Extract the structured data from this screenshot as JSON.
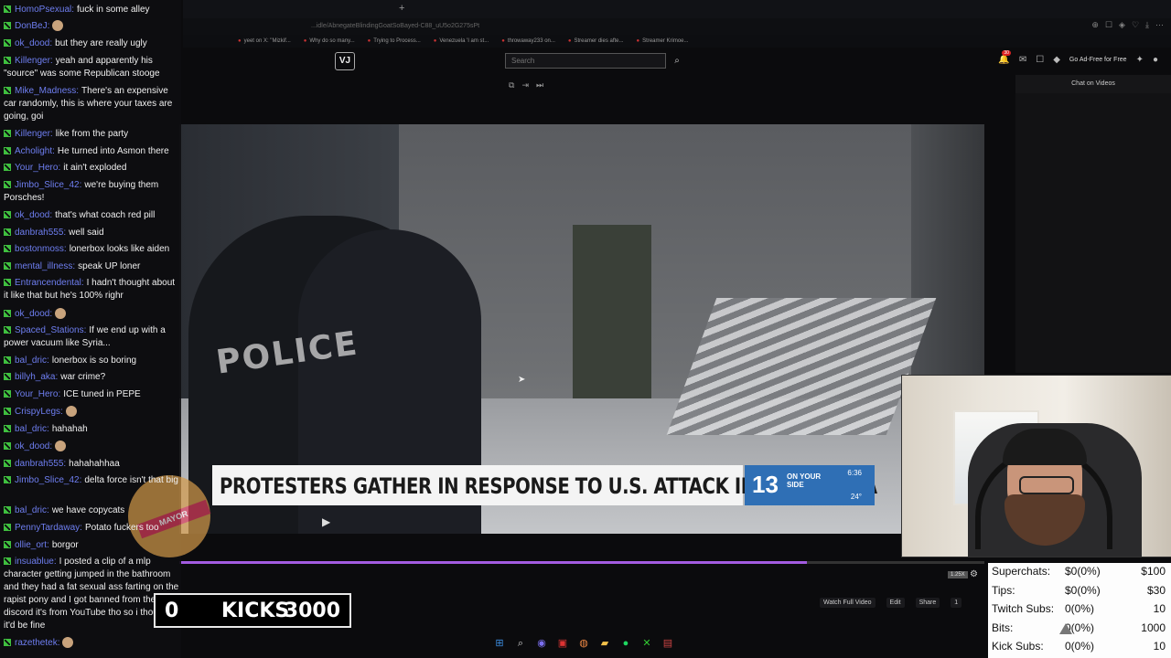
{
  "browser": {
    "new_tab": "+",
    "address": "...idle/AbnegateBlindingGoatSoBayed-C88_uU5o2G275sPt",
    "bookmarks": [
      "yeet on X: \"Mizkif...",
      "Why do so many...",
      "Trying to Process...",
      "Venezuela 'I am st...",
      "throwaway233 on...",
      "Streamer dies afte...",
      "Streamer Krimoe..."
    ]
  },
  "site": {
    "logo": "VJ",
    "search_placeholder": "Search",
    "notif_count": "30",
    "ad_free": "Go Ad-Free for Free"
  },
  "right_chat": {
    "title": "Chat on Videos"
  },
  "video": {
    "police_text": "POLICE",
    "chyron": "PROTESTERS GATHER IN RESPONSE TO U.S. ATTACK IN VENEZUELA",
    "station_number": "13",
    "station_slogan": "ON YOUR SIDE",
    "time": "6:36",
    "temp": "24°",
    "progress": 0.78,
    "speed": "1.25X",
    "actions": {
      "watch_full": "Watch Full Video",
      "edit": "Edit",
      "share": "Share",
      "like": "1"
    }
  },
  "kicks": {
    "count": "0",
    "label": "KICKS",
    "goal": "3000"
  },
  "stats": [
    {
      "label": "Superchats:",
      "value": "$0(0%)",
      "goal": "$100"
    },
    {
      "label": "Tips:",
      "value": "$0(0%)",
      "goal": "$30"
    },
    {
      "label": "Twitch Subs:",
      "value": "0(0%)",
      "goal": "10"
    },
    {
      "label": "Bits:",
      "value": "0(0%)",
      "goal": "1000"
    },
    {
      "label": "Kick Subs:",
      "value": "0(0%)",
      "goal": "10"
    }
  ],
  "chat": [
    {
      "user": "HomoPsexual:",
      "text": "fuck in some alley"
    },
    {
      "user": "DonBeJ:",
      "text": ""
    },
    {
      "user": "ok_dood:",
      "text": "but they are really ugly"
    },
    {
      "user": "Killenger:",
      "text": "yeah and apparently his \"source\" was some Republican stooge"
    },
    {
      "user": "Mike_Madness:",
      "text": "There's an expensive car randomly, this is where your taxes are going, goi"
    },
    {
      "user": "Killenger:",
      "text": "like from the party"
    },
    {
      "user": "Acholight:",
      "text": "He turned into Asmon there"
    },
    {
      "user": "Your_Hero:",
      "text": "it ain't exploded"
    },
    {
      "user": "Jimbo_Slice_42:",
      "text": "we're buying them Porsches!"
    },
    {
      "user": "ok_dood:",
      "text": "that's what coach red pill"
    },
    {
      "user": "danbrah555:",
      "text": "well said"
    },
    {
      "user": "bostonmoss:",
      "text": "lonerbox looks like aiden"
    },
    {
      "user": "mental_illness:",
      "text": "speak UP loner"
    },
    {
      "user": "Entrancendental:",
      "text": "I hadn't thought about it like that but he's 100% righr"
    },
    {
      "user": "ok_dood:",
      "text": ""
    },
    {
      "user": "Spaced_Stations:",
      "text": "If we end up with a power vacuum like Syria..."
    },
    {
      "user": "bal_dric:",
      "text": "lonerbox is so boring"
    },
    {
      "user": "billyh_aka:",
      "text": "war crime?"
    },
    {
      "user": "Your_Hero:",
      "text": "ICE tuned in PEPE"
    },
    {
      "user": "CrispyLegs:",
      "text": ""
    },
    {
      "user": "bal_dric:",
      "text": "hahahah"
    },
    {
      "user": "ok_dood:",
      "text": ""
    },
    {
      "user": "danbrah555:",
      "text": "hahahahhaa"
    },
    {
      "user": "Jimbo_Slice_42:",
      "text": "delta force isn't that big"
    },
    {
      "user": "bal_dric:",
      "text": "we have copycats"
    },
    {
      "user": "PennyTardaway:",
      "text": "Potato fuckers too"
    },
    {
      "user": "ollie_ort:",
      "text": "borgor"
    },
    {
      "user": "insuablue:",
      "text": "I posted a clip of a mlp character getting jumped in the bathroom and they had a fat sexual ass farting on the rapist pony and I got banned from the discord it's from YouTube tho so i thought it'd be fine"
    },
    {
      "user": "razethetek:",
      "text": ""
    }
  ],
  "mascot_sash": "MAYOR",
  "colors": {
    "accent": "#a35be0",
    "username": "#6e7ef0",
    "badge": "#3fbf3f",
    "station": "#2f6fb5"
  }
}
